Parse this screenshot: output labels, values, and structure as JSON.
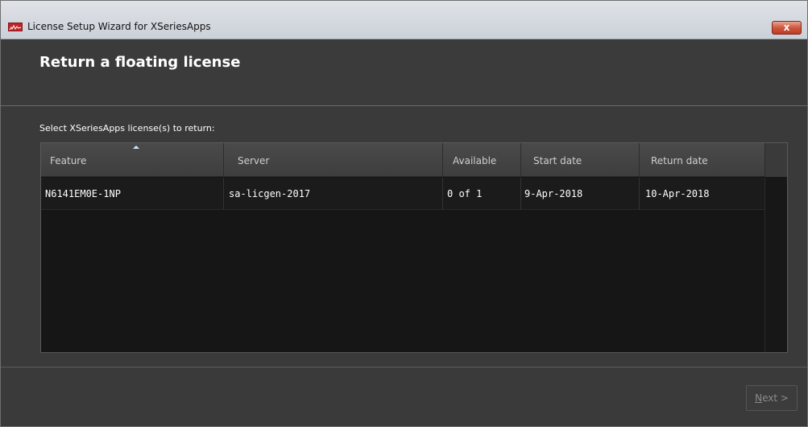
{
  "window": {
    "title": "License Setup Wizard for XSeriesApps",
    "close_label": "x"
  },
  "header": {
    "title": "Return a floating license"
  },
  "main": {
    "instruction": "Select XSeriesApps license(s) to return:",
    "table": {
      "columns": [
        "Feature",
        "Server",
        "Available",
        "Start date",
        "Return date"
      ],
      "sort_column": "Feature",
      "rows": [
        {
          "feature": "N6141EM0E-1NP",
          "server": "sa-licgen-2017",
          "available": "0 of 1",
          "start_date": "9-Apr-2018",
          "return_date": "10-Apr-2018"
        }
      ]
    }
  },
  "footer": {
    "next_mnemonic": "N",
    "next_rest": "ext >"
  },
  "icons": {
    "app": "app-logo-icon",
    "close": "close-icon",
    "sort": "sort-ascending-icon"
  },
  "colors": {
    "window_bg": "#3a3a3a",
    "table_bg": "#161616",
    "close_button": "#d0573f",
    "app_icon": "#c0242a"
  }
}
